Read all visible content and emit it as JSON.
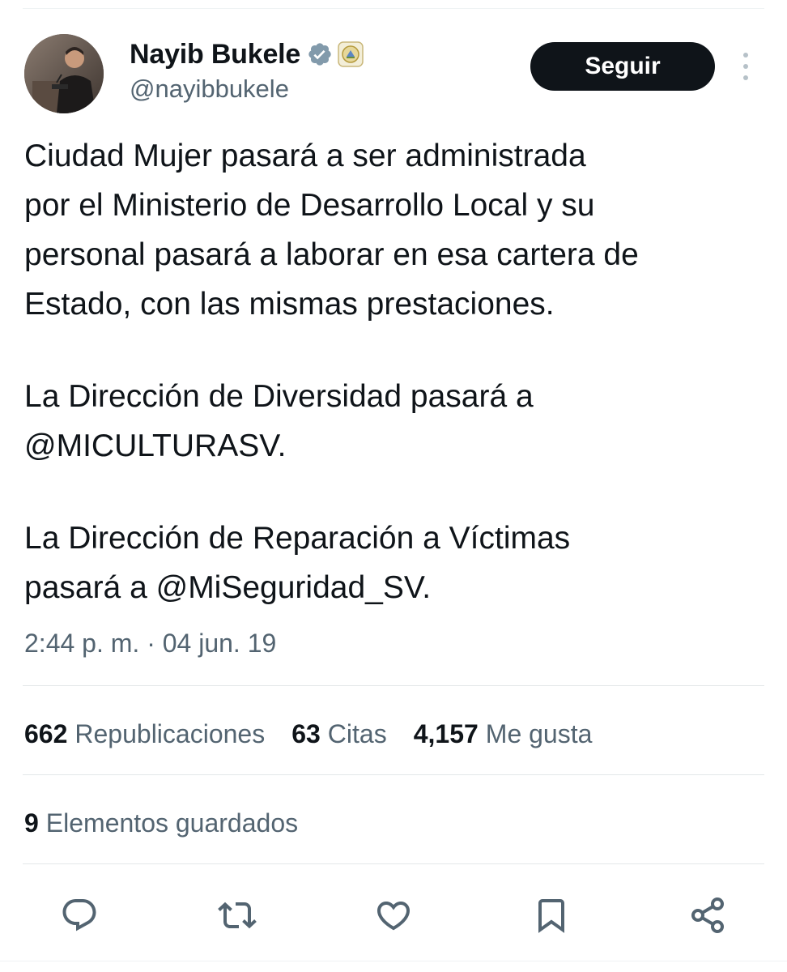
{
  "author": {
    "display_name": "Nayib Bukele",
    "handle": "@nayibbukele",
    "verified_icon": "verified-badge-icon",
    "affiliation_icon": "government-seal-icon",
    "verified_color": "#829aab"
  },
  "header": {
    "follow_label": "Seguir",
    "more_icon": "more-vertical-icon"
  },
  "tweet": {
    "paragraphs": [
      {
        "lines": [
          "Ciudad Mujer pasará a ser administrada",
          "por el Ministerio de Desarrollo Local y su",
          "personal pasará a laborar en esa cartera de",
          "Estado, con las mismas prestaciones."
        ]
      },
      {
        "lines": [
          "La Dirección de Diversidad pasará a",
          "@MICULTURASV."
        ]
      },
      {
        "lines": [
          "La Dirección de Reparación a Víctimas",
          "pasará a @MiSeguridad_SV."
        ]
      }
    ],
    "timestamp": "2:44 p. m. · 04 jun. 19"
  },
  "stats": {
    "reposts_count": "662",
    "reposts_label": "Republicaciones",
    "quotes_count": "63",
    "quotes_label": "Citas",
    "likes_count": "4,157",
    "likes_label": "Me gusta",
    "bookmarks_count": "9",
    "bookmarks_label": "Elementos guardados"
  },
  "actions": [
    {
      "icon": "reply-icon"
    },
    {
      "icon": "repost-icon"
    },
    {
      "icon": "like-icon"
    },
    {
      "icon": "bookmark-icon"
    },
    {
      "icon": "share-icon"
    }
  ],
  "colors": {
    "text_primary": "#0f1419",
    "text_secondary": "#536471",
    "button_bg": "#0f1419",
    "divider": "#e3e7e9"
  }
}
